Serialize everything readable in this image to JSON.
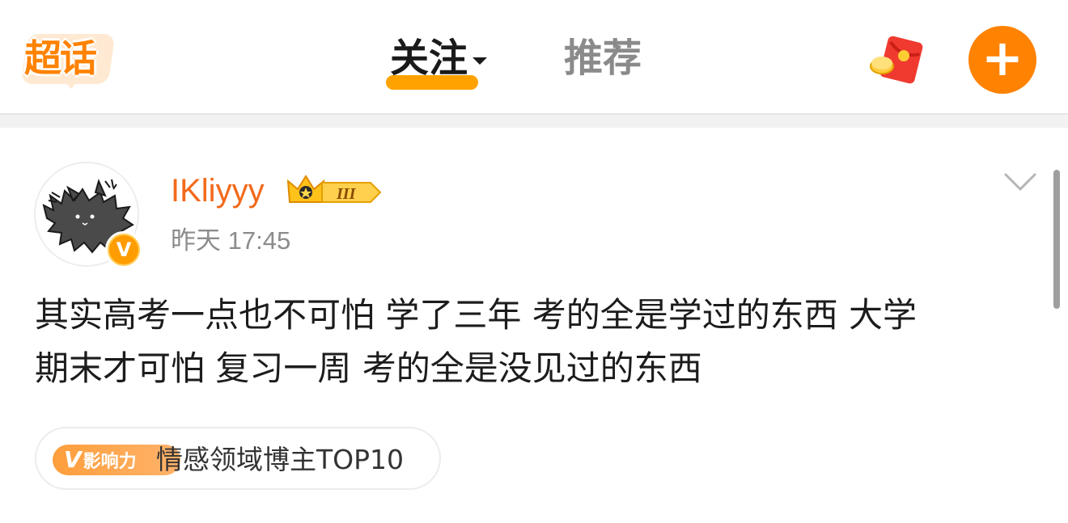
{
  "header": {
    "logo_text": "超话",
    "tabs": [
      {
        "label": "关注",
        "active": true
      },
      {
        "label": "推荐",
        "active": false
      }
    ],
    "plus_label": "+"
  },
  "post": {
    "username": "IKliyyy",
    "level_badge": "III",
    "verified_mark": "V",
    "time": "昨天 17:45",
    "content_line1": "其实高考一点也不可怕 学了三年 考的全是学过的东西 大学",
    "content_line2": "期末才可怕 复习一周 考的全是没见过的东西",
    "influence_badge_v": "V",
    "influence_badge_label": "影响力",
    "influence_tag": "情感领域博主TOP10"
  },
  "colors": {
    "brand_orange": "#ff8200",
    "username": "#f26a1b",
    "tab_highlight": "#ffa200"
  },
  "icons": [
    "red-packet-icon",
    "plus-icon",
    "chevron-down-icon",
    "crown-icon",
    "verified-icon"
  ]
}
